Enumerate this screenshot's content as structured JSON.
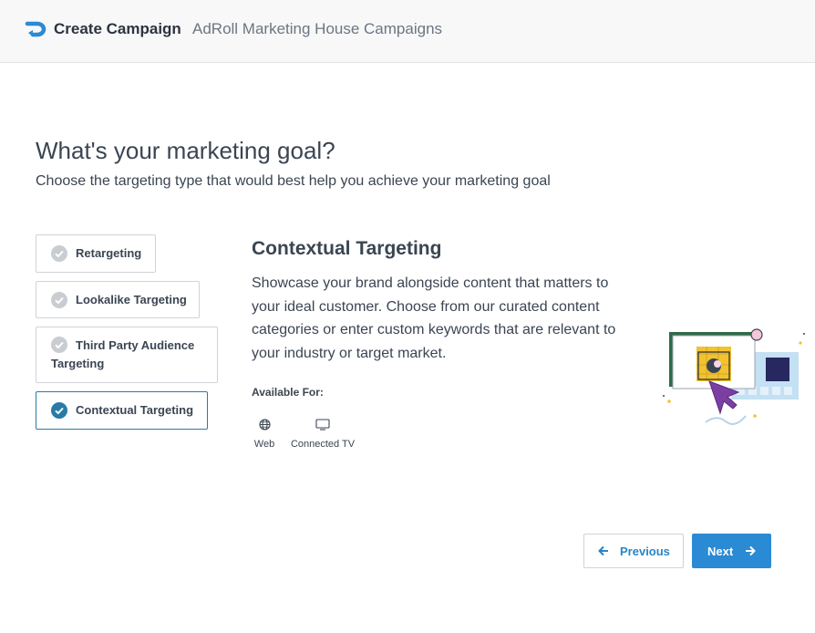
{
  "header": {
    "title": "Create Campaign",
    "subtitle": "AdRoll Marketing House Campaigns",
    "brand_color": "#2a8ad4"
  },
  "goal": {
    "title": "What's your marketing goal?",
    "subtitle": "Choose the targeting type that would best help you achieve your marketing goal"
  },
  "options": [
    {
      "label": "Retargeting",
      "selected": false
    },
    {
      "label": "Lookalike Targeting",
      "selected": false
    },
    {
      "label_line1": "Third Party Audience",
      "label_line2": "Targeting",
      "selected": false
    },
    {
      "label": "Contextual Targeting",
      "selected": true
    }
  ],
  "detail": {
    "title": "Contextual Targeting",
    "description": "Showcase your brand alongside content that matters to your ideal customer. Choose from our curated content categories or enter custom keywords that are relevant to your industry or target market.",
    "available_label": "Available For:",
    "platforms": [
      {
        "label": "Web",
        "icon": "globe-icon"
      },
      {
        "label": "Connected TV",
        "icon": "tv-icon"
      }
    ]
  },
  "buttons": {
    "previous": "Previous",
    "next": "Next"
  },
  "colors": {
    "selected_check": "#2a7aa6",
    "unselected_check": "#c9cdd1",
    "primary": "#2a8ad4"
  }
}
